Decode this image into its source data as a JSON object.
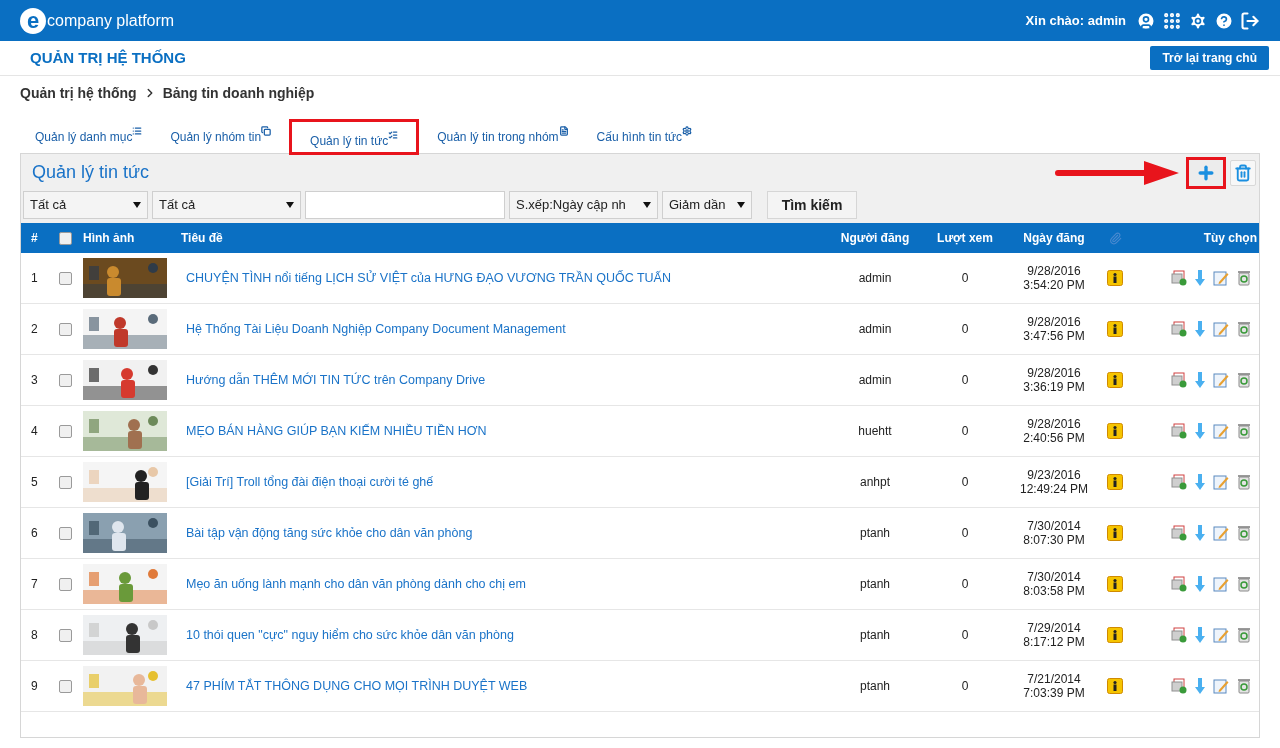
{
  "header": {
    "logo_mark": "e",
    "logo_text": "company platform",
    "greeting": "Xin chào: admin"
  },
  "admin_bar": {
    "title": "QUẢN TRỊ HỆ THỐNG",
    "back_button": "Trở lại trang chủ"
  },
  "breadcrumb": [
    "Quản trị hệ thống",
    "Bảng tin doanh nghiệp"
  ],
  "tabs": [
    {
      "label": "Quản lý danh mục",
      "selected": false
    },
    {
      "label": "Quản lý nhóm tin",
      "selected": false
    },
    {
      "label": "Quản lý tin tức",
      "selected": true
    },
    {
      "label": "Quản lý tin trong nhóm",
      "selected": false
    },
    {
      "label": "Cấu hình tin tức",
      "selected": false
    }
  ],
  "panel": {
    "title": "Quản lý tin tức",
    "add_highlighted": true
  },
  "filters": {
    "category": "Tất cả",
    "group": "Tất cả",
    "sort": "S.xếp:Ngày cập nh",
    "order": "Giảm dần",
    "search_button": "Tìm kiếm"
  },
  "table": {
    "columns": [
      "#",
      "Hình ảnh",
      "Tiêu đề",
      "Người đăng",
      "Lượt xem",
      "Ngày đăng",
      "Tùy chọn"
    ],
    "header_checked": false,
    "rows": [
      {
        "index": "1",
        "checked": false,
        "title": "CHUYỆN TÌNH nổi tiếng LỊCH SỬ VIỆT của HƯNG ĐẠO VƯƠNG TRẦN QUỐC TUẤN",
        "author": "admin",
        "views": "0",
        "date": "9/28/2016",
        "time": "3:54:20 PM"
      },
      {
        "index": "2",
        "checked": false,
        "title": "Hệ Thống Tài Liệu Doanh Nghiệp Company Document Management",
        "author": "admin",
        "views": "0",
        "date": "9/28/2016",
        "time": "3:47:56 PM"
      },
      {
        "index": "3",
        "checked": false,
        "title": "Hướng dẫn THÊM MỚI TIN TỨC trên Company Drive",
        "author": "admin",
        "views": "0",
        "date": "9/28/2016",
        "time": "3:36:19 PM"
      },
      {
        "index": "4",
        "checked": false,
        "title": "MẸO BÁN HÀNG GIÚP BẠN KIẾM NHIỀU TIỀN HƠN",
        "author": "huehtt",
        "views": "0",
        "date": "9/28/2016",
        "time": "2:40:56 PM"
      },
      {
        "index": "5",
        "checked": false,
        "title": "[Giải Trí] Troll tổng đài điện thoại cười té ghế",
        "author": "anhpt",
        "views": "0",
        "date": "9/23/2016",
        "time": "12:49:24 PM"
      },
      {
        "index": "6",
        "checked": false,
        "title": "Bài tập vận động tăng sức khỏe cho dân văn phòng",
        "author": "ptanh",
        "views": "0",
        "date": "7/30/2014",
        "time": "8:07:30 PM"
      },
      {
        "index": "7",
        "checked": false,
        "title": "Mẹo ăn uống lành mạnh cho dân văn phòng dành cho chị em",
        "author": "ptanh",
        "views": "0",
        "date": "7/30/2014",
        "time": "8:03:58 PM"
      },
      {
        "index": "8",
        "checked": false,
        "title": "10 thói quen \"cực\" nguy hiểm cho sức khỏe dân văn phòng",
        "author": "ptanh",
        "views": "0",
        "date": "7/29/2014",
        "time": "8:17:12 PM"
      },
      {
        "index": "9",
        "checked": false,
        "title": "47 PHÍM TẮT THÔNG DỤNG CHO MỌI TRÌNH DUYỆT WEB",
        "author": "ptanh",
        "views": "0",
        "date": "7/21/2014",
        "time": "7:03:39 PM"
      }
    ]
  }
}
